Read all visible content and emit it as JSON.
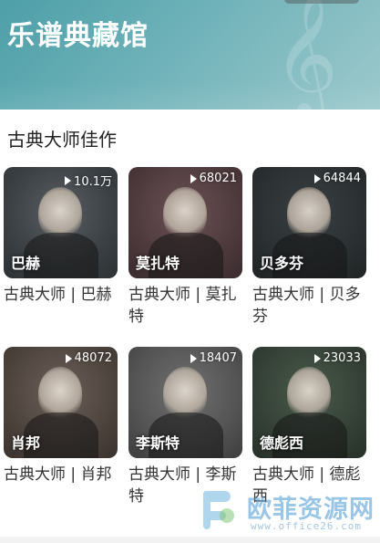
{
  "header": {
    "title": "乐谱典藏馆"
  },
  "section": {
    "title": "古典大师佳作"
  },
  "cards": [
    {
      "name": "巴赫",
      "plays": "10.1万",
      "caption": "古典大师 | 巴赫"
    },
    {
      "name": "莫扎特",
      "plays": "68021",
      "caption": "古典大师 | 莫扎特"
    },
    {
      "name": "贝多芬",
      "plays": "64844",
      "caption": "古典大师 | 贝多芬"
    },
    {
      "name": "肖邦",
      "plays": "48072",
      "caption": "古典大师 | 肖邦"
    },
    {
      "name": "李斯特",
      "plays": "18407",
      "caption": "古典大师 | 李斯特"
    },
    {
      "name": "德彪西",
      "plays": "23033",
      "caption": "古典大师 | 德彪西"
    }
  ],
  "watermark": {
    "text": "欧菲资源网",
    "url": "www.office26.com"
  },
  "colors": {
    "banner": "#6fb2b9",
    "play_icon": "#ffffff"
  },
  "icons": {
    "play": "play-icon",
    "logo": "office26-logo-icon"
  }
}
